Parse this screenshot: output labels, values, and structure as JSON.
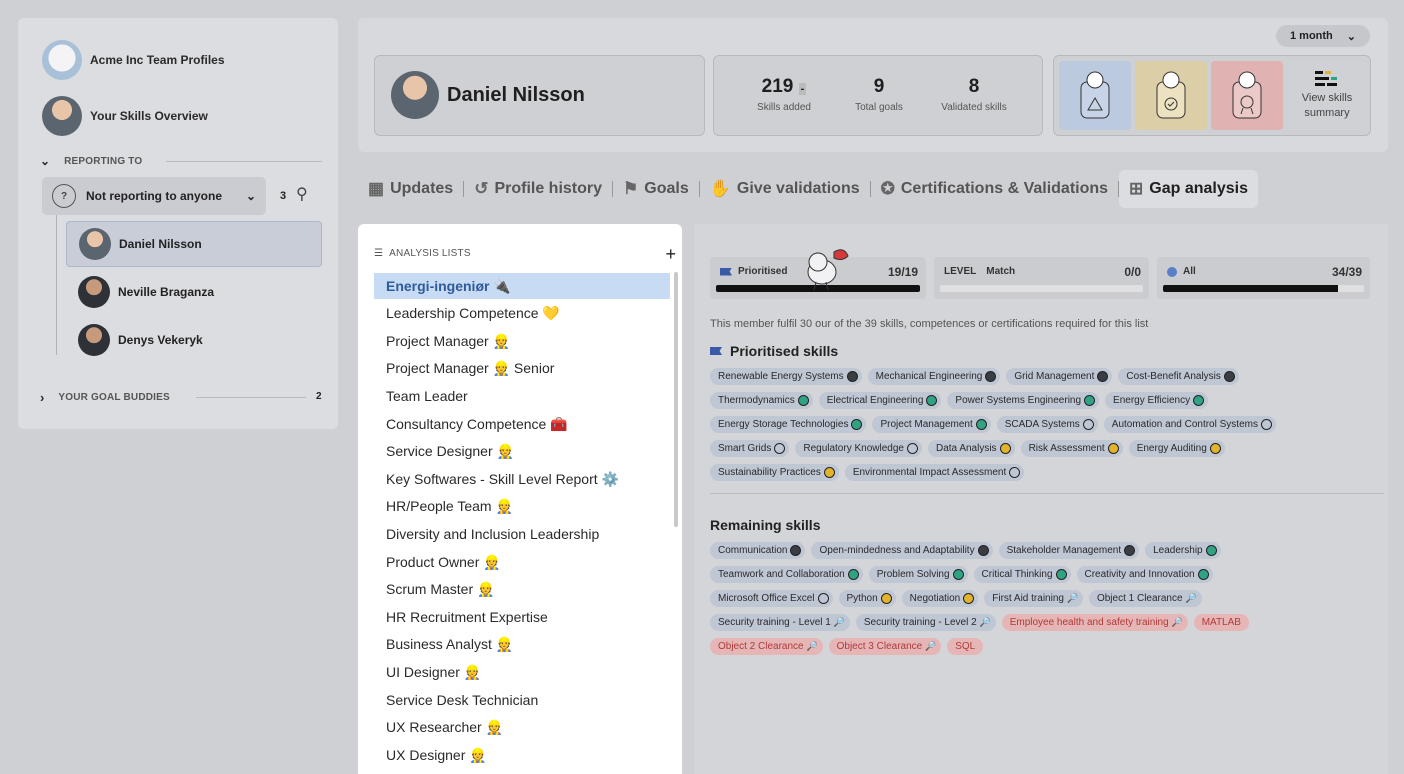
{
  "sidebar": {
    "team_profiles": "Acme Inc Team Profiles",
    "skills_overview": "Your Skills Overview",
    "reporting_to": "REPORTING TO",
    "reporting_value": "Not reporting to anyone",
    "report_count": "3",
    "people": [
      "Daniel Nilsson",
      "Neville Braganza",
      "Denys Vekeryk"
    ],
    "goal_buddies": "YOUR GOAL BUDDIES",
    "goal_buddies_count": "2"
  },
  "header": {
    "period": "1 month",
    "name": "Daniel Nilsson",
    "stats": [
      {
        "value": "219",
        "label": "Skills added"
      },
      {
        "value": "9",
        "label": "Total goals"
      },
      {
        "value": "8",
        "label": "Validated skills"
      }
    ],
    "stat_dash": "-",
    "view_summary": "View skills summary"
  },
  "tabs": [
    "Updates",
    "Profile history",
    "Goals",
    "Give validations",
    "Certifications & Validations",
    "Gap analysis"
  ],
  "lists": {
    "title": "ANALYSIS LISTS",
    "items": [
      "Energi-ingeniør 🔌",
      "Leadership Competence 💛",
      "Project Manager 👷",
      "Project Manager 👷 Senior",
      "Team Leader",
      "Consultancy Competence 🧰",
      "Service Designer 👷",
      "Key Softwares - Skill Level Report ⚙️",
      "HR/People Team 👷",
      "Diversity and Inclusion Leadership",
      "Product Owner 👷",
      "Scrum Master 👷",
      "HR Recruitment Expertise",
      "Business Analyst 👷",
      "UI Designer 👷",
      "Service Desk Technician",
      "UX Researcher 👷",
      "UX Designer 👷"
    ]
  },
  "analysis": {
    "prioritised_label": "Prioritised",
    "prioritised_value": "19/19",
    "prioritised_fill": 1.0,
    "level_label": "LEVEL",
    "match_label": "Match",
    "match_value": "0/0",
    "match_fill": 0,
    "all_label": "All",
    "all_value": "34/39",
    "all_fill": 0.872,
    "description": "This member fulfil 30 our of the 39 skills, competences or certifications required for this list",
    "prioritised_title": "Prioritised skills",
    "remaining_title": "Remaining skills",
    "prioritised_skills": [
      [
        [
          "Renewable Energy Systems",
          "dark"
        ],
        [
          "Mechanical Engineering",
          "dark"
        ],
        [
          "Grid Management",
          "dark"
        ],
        [
          "Cost-Benefit Analysis",
          "dark"
        ]
      ],
      [
        [
          "Thermodynamics",
          "green"
        ],
        [
          "Electrical Engineering",
          "green"
        ],
        [
          "Power Systems Engineering",
          "green"
        ],
        [
          "Energy Efficiency",
          "green"
        ]
      ],
      [
        [
          "Energy Storage Technologies",
          "green"
        ],
        [
          "Project Management",
          "green"
        ],
        [
          "SCADA Systems",
          "empty"
        ],
        [
          "Automation and Control Systems",
          "empty"
        ]
      ],
      [
        [
          "Smart Grids",
          "empty"
        ],
        [
          "Regulatory Knowledge",
          "empty"
        ],
        [
          "Data Analysis",
          "yellow"
        ],
        [
          "Risk Assessment",
          "yellow"
        ],
        [
          "Energy Auditing",
          "yellow"
        ]
      ],
      [
        [
          "Sustainability Practices",
          "yellow"
        ],
        [
          "Environmental Impact Assessment",
          "empty"
        ]
      ]
    ],
    "remaining_skills": [
      [
        [
          "Communication",
          "dark"
        ],
        [
          "Open-mindedness and Adaptability",
          "dark"
        ],
        [
          "Stakeholder Management",
          "dark"
        ],
        [
          "Leadership",
          "green"
        ]
      ],
      [
        [
          "Teamwork and Collaboration",
          "green"
        ],
        [
          "Problem Solving",
          "green"
        ],
        [
          "Critical Thinking",
          "green"
        ],
        [
          "Creativity and Innovation",
          "green"
        ]
      ],
      [
        [
          "Microsoft Office Excel",
          "empty"
        ],
        [
          "Python",
          "yellow"
        ],
        [
          "Negotiation",
          "yellow"
        ],
        [
          "First Aid training",
          "search"
        ],
        [
          "Object 1 Clearance",
          "search"
        ]
      ],
      [
        [
          "Security training - Level 1",
          "search"
        ],
        [
          "Security training - Level 2",
          "search"
        ],
        [
          "Employee health and safety training",
          "search-red"
        ],
        [
          "MATLAB",
          "red"
        ]
      ],
      [
        [
          "Object 2 Clearance",
          "search-red"
        ],
        [
          "Object 3 Clearance",
          "search-red"
        ],
        [
          "SQL",
          "red"
        ]
      ]
    ]
  }
}
